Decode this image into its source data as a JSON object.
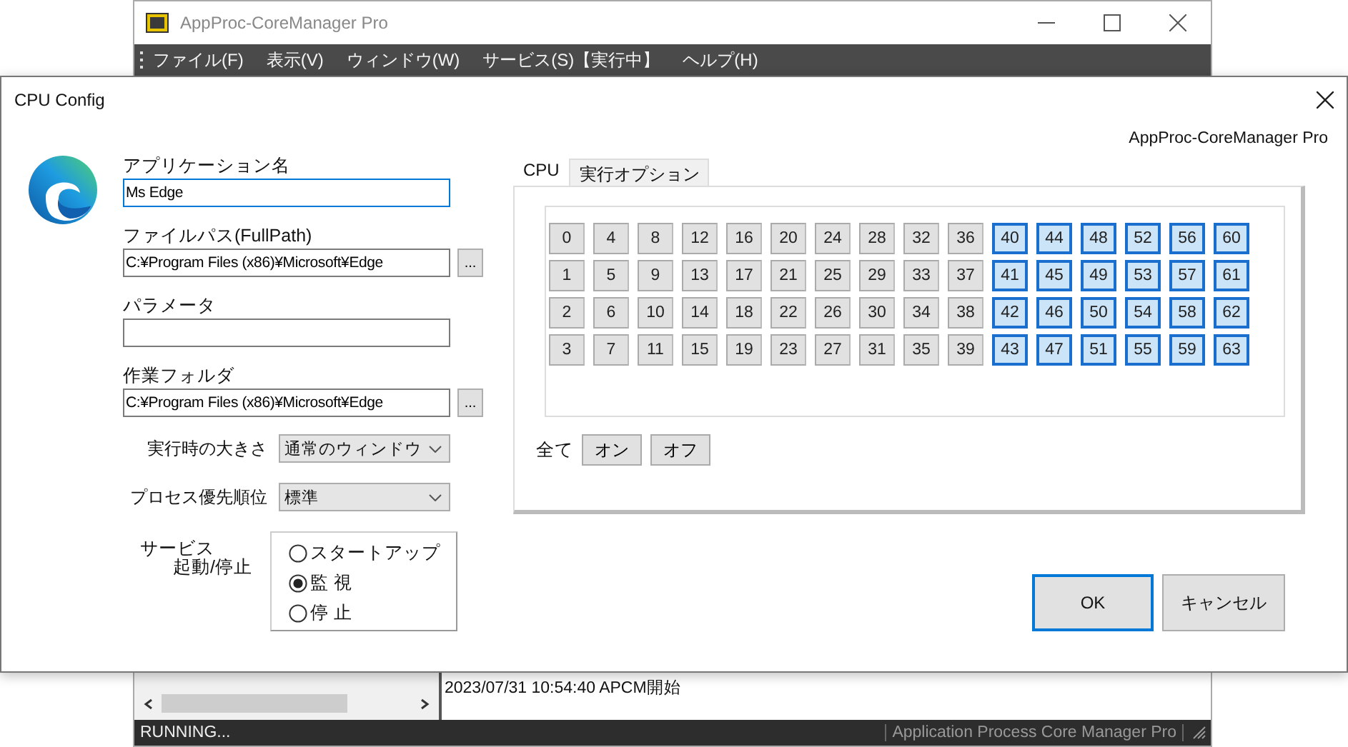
{
  "main_window": {
    "title": "AppProc-CoreManager Pro",
    "menu": [
      "ファイル(F)",
      "表示(V)",
      "ウィンドウ(W)",
      "サービス(S)【実行中】",
      "ヘルプ(H)"
    ],
    "log": [
      "2023/07/31 10:54:40 APCM開始"
    ],
    "status_bar": {
      "left": "RUNNING...",
      "right": "Application Process Core Manager  Pro"
    }
  },
  "dialog": {
    "title": "CPU Config",
    "product": "AppProc-CoreManager Pro",
    "fields": [
      {
        "label": "アプリケーション名",
        "value": "Ms Edge",
        "focused": true
      },
      {
        "label": "ファイルパス(FullPath)",
        "value": "C:¥Program Files (x86)¥Microsoft¥Edge",
        "browse_label": "...",
        "focused": false
      },
      {
        "label": "パラメータ",
        "focused": false
      },
      {
        "label": "作業フォルダ",
        "value": "C:¥Program Files (x86)¥Microsoft¥Edge",
        "browse_label": "...",
        "focused": false
      }
    ],
    "dropdowns": [
      {
        "label": "実行時の大きさ",
        "value": "通常のウィンドウ"
      },
      {
        "label": "プロセス優先順位",
        "value": "標準"
      }
    ],
    "service": {
      "label_1": "サービス",
      "label_2": "起動/停止",
      "options": [
        {
          "label": "スタートアップ",
          "selected": false
        },
        {
          "label": "監 視",
          "selected": true
        },
        {
          "label": "停 止",
          "selected": false
        }
      ]
    },
    "tabs": [
      {
        "label": "CPU",
        "selected": true
      },
      {
        "label": "実行オプション",
        "selected": false
      }
    ],
    "core_rows": [
      [
        {
          "label": "0",
          "selected": false
        },
        {
          "label": "4",
          "selected": false
        },
        {
          "label": "8",
          "selected": false
        },
        {
          "label": "12",
          "selected": false
        },
        {
          "label": "16",
          "selected": false
        },
        {
          "label": "20",
          "selected": false
        },
        {
          "label": "24",
          "selected": false
        },
        {
          "label": "28",
          "selected": false
        },
        {
          "label": "32",
          "selected": false
        },
        {
          "label": "36",
          "selected": false
        },
        {
          "label": "40",
          "selected": true
        },
        {
          "label": "44",
          "selected": true
        },
        {
          "label": "48",
          "selected": true
        },
        {
          "label": "52",
          "selected": true
        },
        {
          "label": "56",
          "selected": true
        },
        {
          "label": "60",
          "selected": true
        }
      ],
      [
        {
          "label": "1",
          "selected": false
        },
        {
          "label": "5",
          "selected": false
        },
        {
          "label": "9",
          "selected": false
        },
        {
          "label": "13",
          "selected": false
        },
        {
          "label": "17",
          "selected": false
        },
        {
          "label": "21",
          "selected": false
        },
        {
          "label": "25",
          "selected": false
        },
        {
          "label": "29",
          "selected": false
        },
        {
          "label": "33",
          "selected": false
        },
        {
          "label": "37",
          "selected": false
        },
        {
          "label": "41",
          "selected": true
        },
        {
          "label": "45",
          "selected": true
        },
        {
          "label": "49",
          "selected": true
        },
        {
          "label": "53",
          "selected": true
        },
        {
          "label": "57",
          "selected": true
        },
        {
          "label": "61",
          "selected": true
        }
      ],
      [
        {
          "label": "2",
          "selected": false
        },
        {
          "label": "6",
          "selected": false
        },
        {
          "label": "10",
          "selected": false
        },
        {
          "label": "14",
          "selected": false
        },
        {
          "label": "18",
          "selected": false
        },
        {
          "label": "22",
          "selected": false
        },
        {
          "label": "26",
          "selected": false
        },
        {
          "label": "30",
          "selected": false
        },
        {
          "label": "34",
          "selected": false
        },
        {
          "label": "38",
          "selected": false
        },
        {
          "label": "42",
          "selected": true
        },
        {
          "label": "46",
          "selected": true
        },
        {
          "label": "50",
          "selected": true
        },
        {
          "label": "54",
          "selected": true
        },
        {
          "label": "58",
          "selected": true
        },
        {
          "label": "62",
          "selected": true
        }
      ],
      [
        {
          "label": "3",
          "selected": false
        },
        {
          "label": "7",
          "selected": false
        },
        {
          "label": "11",
          "selected": false
        },
        {
          "label": "15",
          "selected": false
        },
        {
          "label": "19",
          "selected": false
        },
        {
          "label": "23",
          "selected": false
        },
        {
          "label": "27",
          "selected": false
        },
        {
          "label": "31",
          "selected": false
        },
        {
          "label": "35",
          "selected": false
        },
        {
          "label": "39",
          "selected": false
        },
        {
          "label": "43",
          "selected": true
        },
        {
          "label": "47",
          "selected": true
        },
        {
          "label": "51",
          "selected": true
        },
        {
          "label": "55",
          "selected": true
        },
        {
          "label": "59",
          "selected": true
        },
        {
          "label": "63",
          "selected": true
        }
      ]
    ],
    "all_label": "全て",
    "all_buttons": [
      "オン",
      "オフ"
    ],
    "buttons": [
      {
        "label": "OK",
        "default": true
      },
      {
        "label": "キャンセル",
        "default": false
      }
    ]
  }
}
